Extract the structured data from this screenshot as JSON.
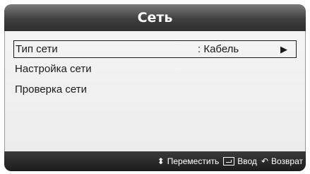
{
  "header": {
    "title": "Сеть"
  },
  "menu": {
    "items": [
      {
        "label": "Тип сети",
        "value": ": Кабель",
        "arrow_icon": "play-right-icon",
        "selected": true
      },
      {
        "label": "Настройка сети"
      },
      {
        "label": "Проверка сети"
      }
    ]
  },
  "footer": {
    "move_icon": "up-down-arrows-icon",
    "move_label": "Переместить",
    "enter_icon": "enter-icon",
    "enter_label": "Ввод",
    "return_icon": "return-arrow-icon",
    "return_label": "Возврат"
  },
  "colors": {
    "title_bar": "#3f3f3f",
    "panel_bg": "#f0f0f0",
    "footer_bg": "#1c1c1c",
    "text": "#1a1a1a"
  }
}
